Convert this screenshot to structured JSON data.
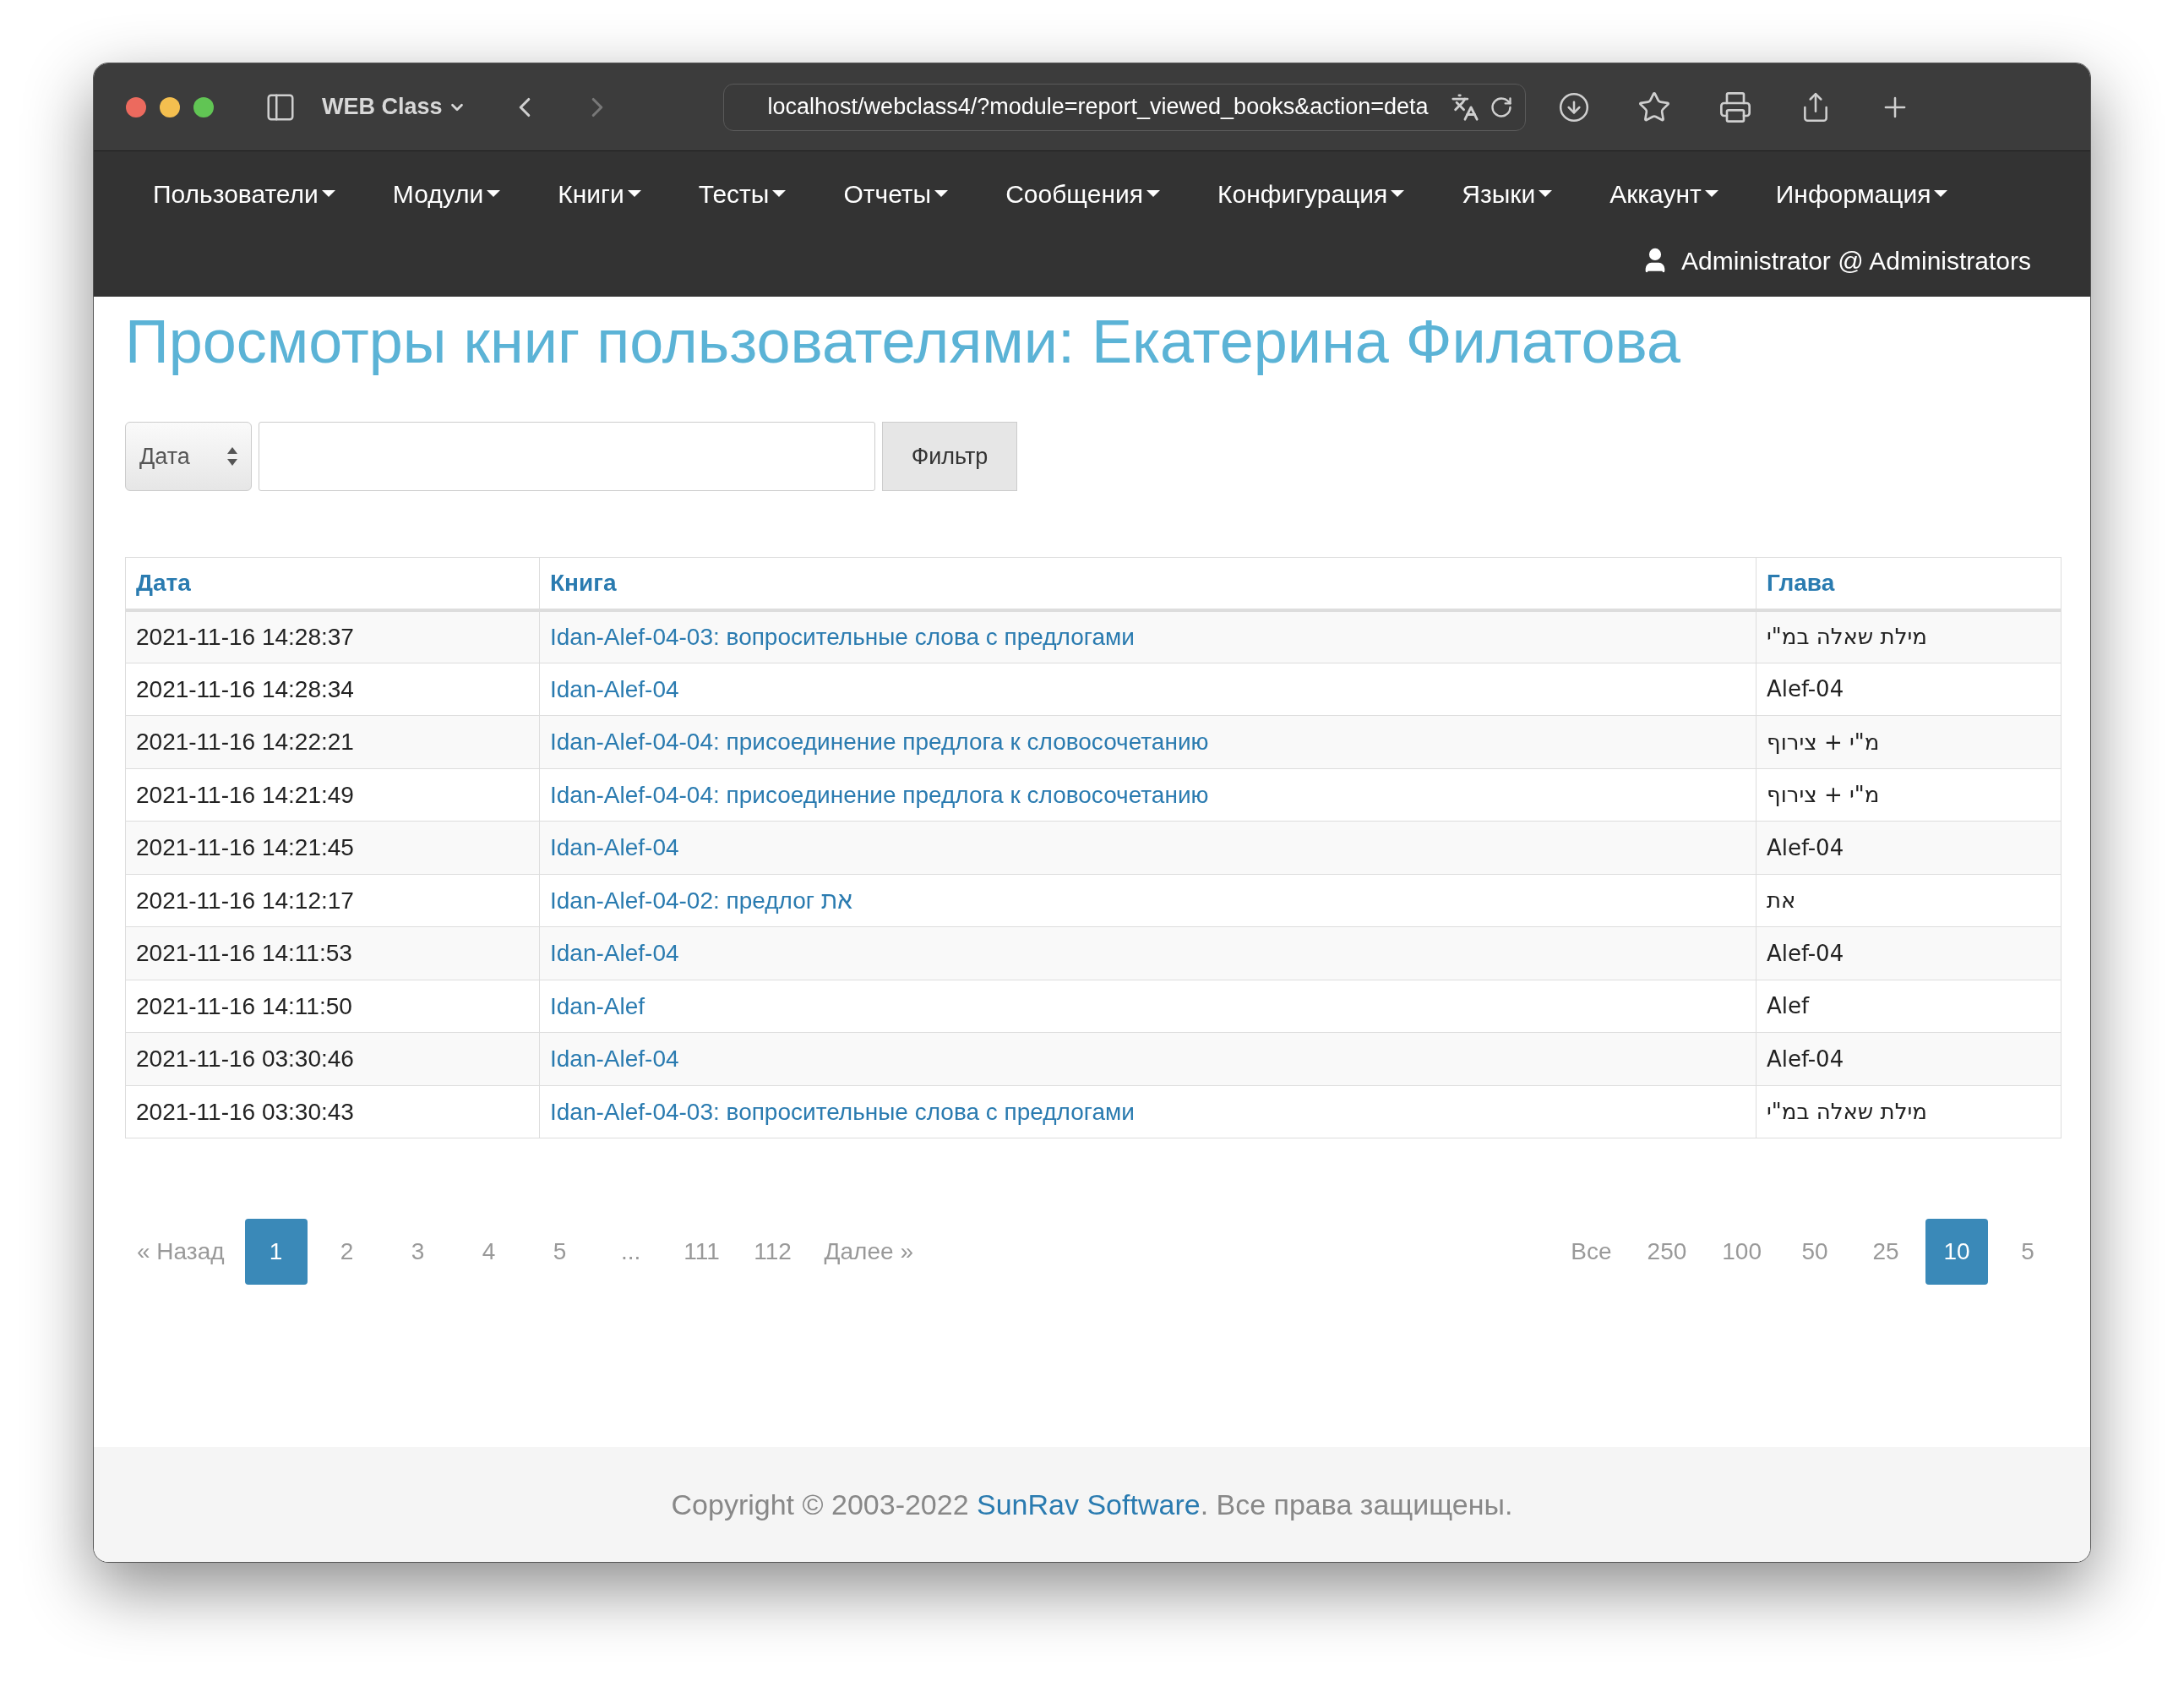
{
  "browser": {
    "tab_title": "WEB Class",
    "url": "localhost/webclass4/?module=report_viewed_books&action=deta"
  },
  "nav": {
    "items": [
      {
        "label": "Пользователи"
      },
      {
        "label": "Модули"
      },
      {
        "label": "Книги"
      },
      {
        "label": "Тесты"
      },
      {
        "label": "Отчеты"
      },
      {
        "label": "Сообщения"
      },
      {
        "label": "Конфигурация"
      },
      {
        "label": "Языки"
      },
      {
        "label": "Аккаунт"
      },
      {
        "label": "Информация"
      }
    ],
    "user": "Administrator @ Administrators"
  },
  "title": "Просмотры книг пользователями: Екатерина Филатова",
  "filter": {
    "select_value": "Дата",
    "button": "Фильтр"
  },
  "table": {
    "columns": [
      "Дата",
      "Книга",
      "Глава"
    ],
    "rows": [
      {
        "date": "2021-11-16 14:28:37",
        "book": "Idan-Alef-04-03: вопросительные слова с предлогами",
        "chapter": "מילת שאלה במ\"י"
      },
      {
        "date": "2021-11-16 14:28:34",
        "book": "Idan-Alef-04",
        "chapter": "Alef-04"
      },
      {
        "date": "2021-11-16 14:22:21",
        "book": "Idan-Alef-04-04: присоединение предлога к словосочетанию",
        "chapter": "מ\"י + צירוף"
      },
      {
        "date": "2021-11-16 14:21:49",
        "book": "Idan-Alef-04-04: присоединение предлога к словосочетанию",
        "chapter": "מ\"י + צירוף"
      },
      {
        "date": "2021-11-16 14:21:45",
        "book": "Idan-Alef-04",
        "chapter": "Alef-04"
      },
      {
        "date": "2021-11-16 14:12:17",
        "book": "Idan-Alef-04-02: предлог את",
        "chapter": "את"
      },
      {
        "date": "2021-11-16 14:11:53",
        "book": "Idan-Alef-04",
        "chapter": "Alef-04"
      },
      {
        "date": "2021-11-16 14:11:50",
        "book": "Idan-Alef",
        "chapter": "Alef"
      },
      {
        "date": "2021-11-16 03:30:46",
        "book": "Idan-Alef-04",
        "chapter": "Alef-04"
      },
      {
        "date": "2021-11-16 03:30:43",
        "book": "Idan-Alef-04-03: вопросительные слова с предлогами",
        "chapter": "מילת שאלה במ\"י"
      }
    ]
  },
  "pagination": {
    "prev": "« Назад",
    "pages": [
      {
        "label": "1",
        "selected": true
      },
      {
        "label": "2",
        "selected": false
      },
      {
        "label": "3",
        "selected": false
      },
      {
        "label": "4",
        "selected": false
      },
      {
        "label": "5",
        "selected": false
      },
      {
        "label": "...",
        "selected": false
      },
      {
        "label": "111",
        "selected": false
      },
      {
        "label": "112",
        "selected": false
      }
    ],
    "next": "Далее »"
  },
  "page_sizes": [
    {
      "label": "Все",
      "selected": false
    },
    {
      "label": "250",
      "selected": false
    },
    {
      "label": "100",
      "selected": false
    },
    {
      "label": "50",
      "selected": false
    },
    {
      "label": "25",
      "selected": false
    },
    {
      "label": "10",
      "selected": true
    },
    {
      "label": "5",
      "selected": false
    }
  ],
  "footer": {
    "before": "Copyright © 2003-2022 ",
    "link": "SunRav Software",
    "after": ". Все права защищены."
  }
}
